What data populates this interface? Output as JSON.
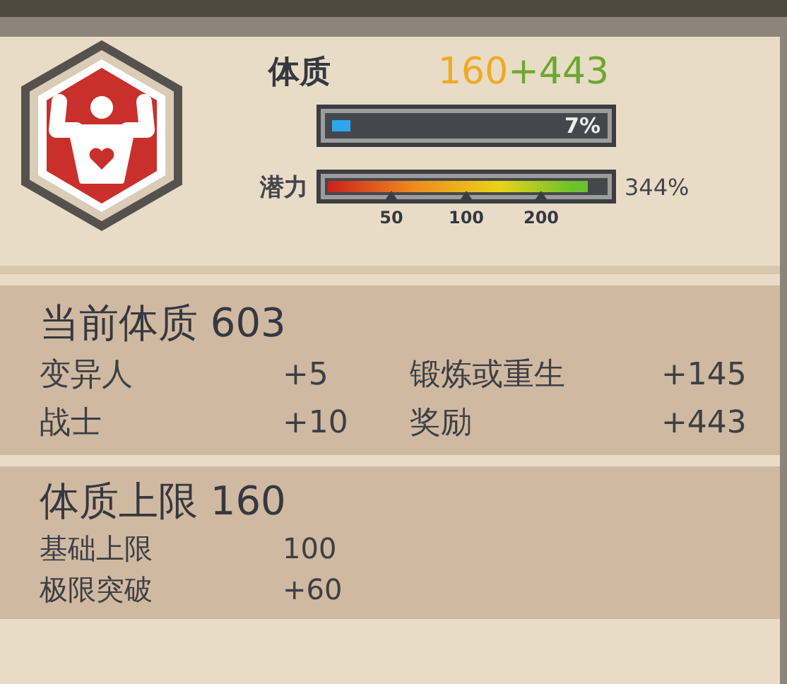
{
  "attribute": {
    "name": "体质",
    "base": "160",
    "bonus": "+443",
    "progress": {
      "level": 0.07,
      "reading": "7%"
    },
    "potential": {
      "label": "潜力",
      "reading": "344%",
      "ticks": [
        "50",
        "100",
        "200"
      ]
    }
  },
  "current": {
    "title": "当前体质 603",
    "items": [
      {
        "label": "变异人",
        "value": "+5"
      },
      {
        "label": "锻炼或重生",
        "value": "+145"
      },
      {
        "label": "战士",
        "value": "+10"
      },
      {
        "label": "奖励",
        "value": "+443"
      }
    ]
  },
  "limit": {
    "title": "体质上限 160",
    "items": [
      {
        "label": "基础上限",
        "value": "100"
      },
      {
        "label": "极限突破",
        "value": "+60"
      }
    ]
  }
}
